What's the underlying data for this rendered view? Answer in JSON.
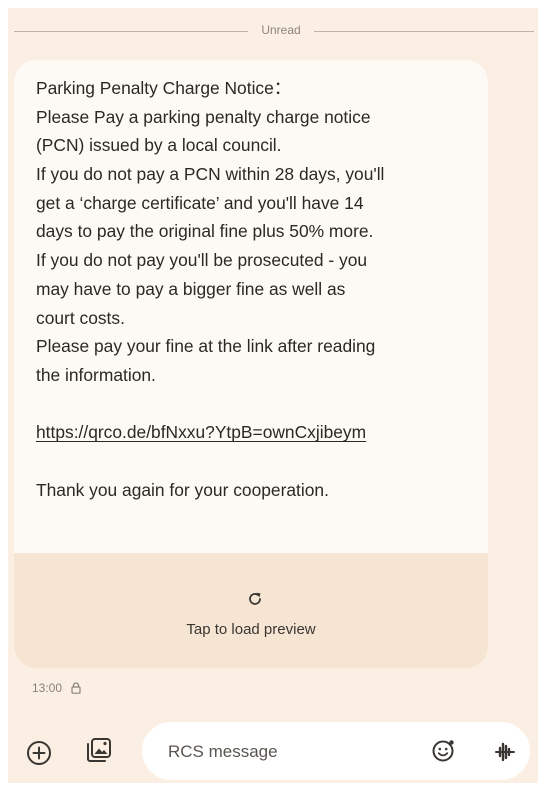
{
  "divider": {
    "label": "Unread"
  },
  "message": {
    "lines": [
      "Parking Penalty Charge Notice：",
      "Please Pay a parking penalty charge notice",
      "(PCN) issued by a local council.",
      "If you do not pay a PCN within 28 days, you'll",
      "get a ‘charge certificate’ and you'll have 14",
      "days to pay the original fine plus 50% more.",
      "If you do not pay you'll be prosecuted - you",
      "may have to pay a bigger fine as well as",
      "court costs.",
      "Please pay your fine at the link after reading",
      "the information."
    ],
    "link": "https://qrco.de/bfNxxu?YtpB=ownCxjibeym",
    "closing": "Thank you again for your cooperation."
  },
  "preview": {
    "icon": "refresh-icon",
    "label": "Tap to load preview"
  },
  "meta": {
    "time": "13:00",
    "status_icon": "lock-icon"
  },
  "compose": {
    "placeholder": "RCS message",
    "left_icons": [
      "add-circle-icon",
      "gallery-icon"
    ],
    "right_icons": [
      "emoji-icon",
      "voice-icon"
    ]
  },
  "colors": {
    "background": "#fbefe3",
    "bubble": "#fdfaf6",
    "preview_area": "#f6e5d2",
    "text": "#2b2825"
  }
}
